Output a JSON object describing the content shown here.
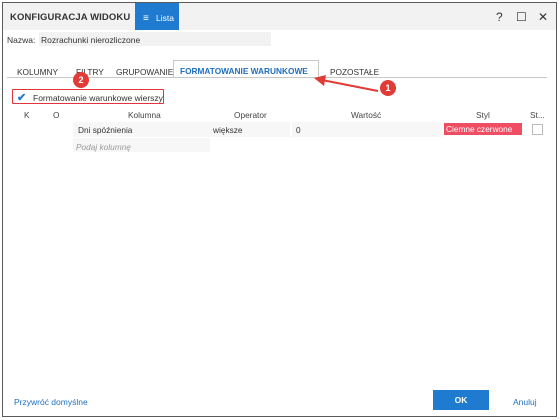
{
  "window": {
    "title": "KONFIGURACJA WIDOKU",
    "view_tab_label": "Lista",
    "help_glyph": "?",
    "maximize_glyph": "☐",
    "close_glyph": "✕"
  },
  "name_field": {
    "label": "Nazwa:",
    "value": "Rozrachunki nierozliczone"
  },
  "tabs": [
    {
      "label": "KOLUMNY"
    },
    {
      "label": "FILTRY"
    },
    {
      "label": "GRUPOWANIE"
    },
    {
      "label": "FORMATOWANIE WARUNKOWE",
      "active": true
    },
    {
      "label": "POZOSTAŁE"
    }
  ],
  "row_formatting_checkbox": {
    "label": "Formatowanie warunkowe wierszy",
    "checked": true
  },
  "table": {
    "headers": {
      "k": "K",
      "o": "O",
      "column": "Kolumna",
      "operator": "Operator",
      "value": "Wartość",
      "style": "Styl",
      "st": "St..."
    },
    "row": {
      "column": "Dni spóźnienia",
      "operator": "większe",
      "value": "0",
      "style": "Ciemne czerwone",
      "style_color": "#ef4d63"
    },
    "placeholder": "Podaj kolumnę"
  },
  "callouts": {
    "one": "1",
    "two": "2",
    "color": "#e13b37"
  },
  "footer": {
    "reset_label": "Przywróć domyślne",
    "ok_label": "OK",
    "cancel_label": "Anuluj"
  },
  "colors": {
    "accent": "#1e7bd0",
    "link": "#1e6fbf"
  }
}
